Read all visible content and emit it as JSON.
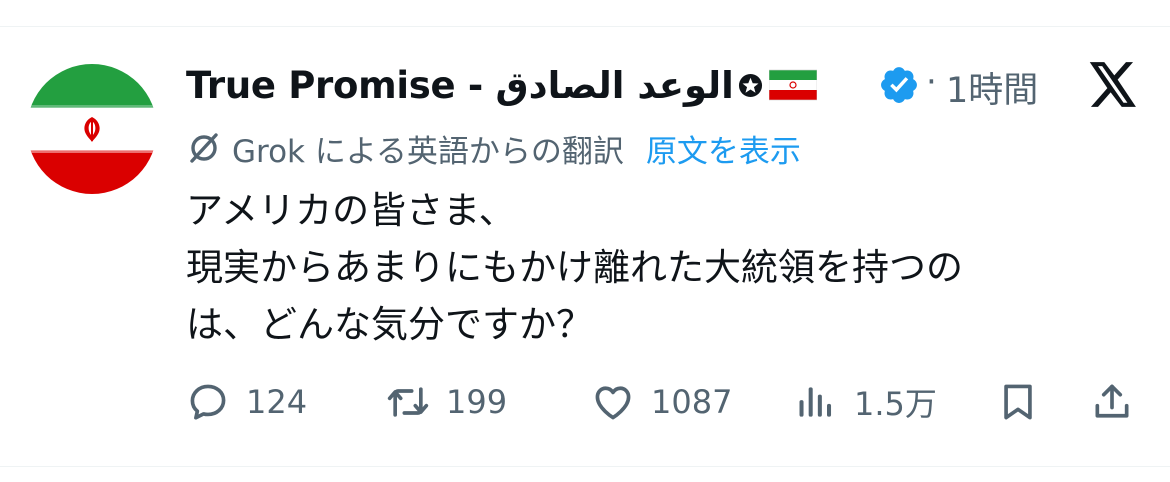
{
  "post": {
    "author": {
      "display_name": "True Promise - الوعد الصادق",
      "avatar_icon": "iran-flag-avatar",
      "verified": true,
      "badges": [
        "star-icon",
        "iran-flag-icon",
        "verified-badge-icon"
      ]
    },
    "time_separator": "·",
    "timestamp": "1時間",
    "platform_logo": "x-logo-icon",
    "translation": {
      "label": "Grok による英語からの翻訳",
      "show_original": "原文を表示"
    },
    "text_lines": [
      "アメリカの皆さま、",
      "現実からあまりにもかけ離れた大統領を持つの",
      "は、どんな気分ですか？"
    ],
    "actions": {
      "replies": "124",
      "reposts": "199",
      "likes": "1087",
      "views": "1.5万"
    }
  },
  "colors": {
    "text": "#0f1419",
    "secondary": "#536471",
    "link": "#1d9bf0",
    "divider": "#eff3f4",
    "flag_green": "#239f40",
    "flag_red": "#da0000"
  }
}
